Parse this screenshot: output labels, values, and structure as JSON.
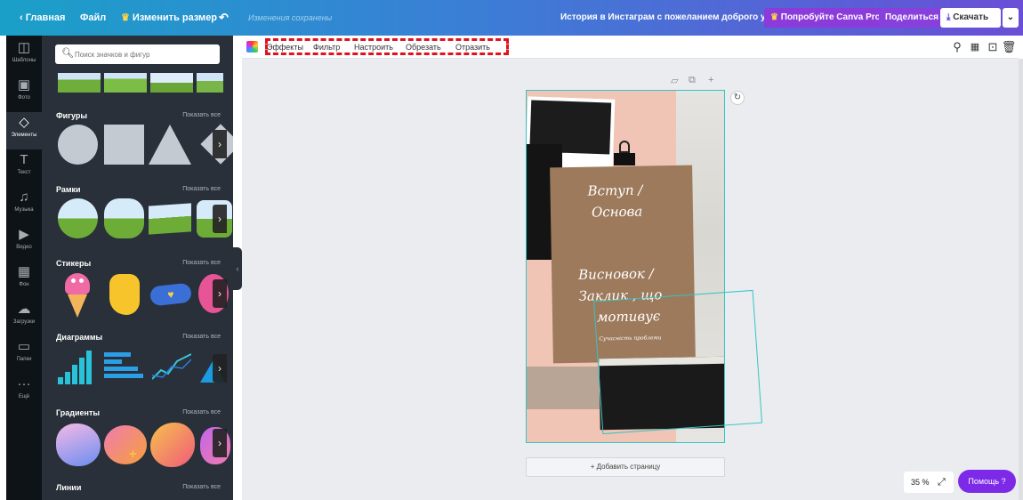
{
  "topbar": {
    "home": "Главная",
    "file": "Файл",
    "resize": "Изменить размер",
    "saved_status": "Изменения сохранены",
    "doc_title": "История в Инстаграм с пожеланием доброго утра",
    "try_pro": "Попробуйте Canva Pro",
    "share": "Поделиться",
    "download": "Скачать"
  },
  "rail": [
    {
      "label": "Шаблоны",
      "icon": "templates-icon",
      "glyph": "◫"
    },
    {
      "label": "Фото",
      "icon": "photo-icon",
      "glyph": "▣"
    },
    {
      "label": "Элементы",
      "icon": "elements-icon",
      "glyph": "◇"
    },
    {
      "label": "Текст",
      "icon": "text-icon",
      "glyph": "T"
    },
    {
      "label": "Музыка",
      "icon": "music-icon",
      "glyph": "♫"
    },
    {
      "label": "Видео",
      "icon": "video-icon",
      "glyph": "▶"
    },
    {
      "label": "Фон",
      "icon": "background-icon",
      "glyph": "▦"
    },
    {
      "label": "Загрузки",
      "icon": "upload-icon",
      "glyph": "☁"
    },
    {
      "label": "Папки",
      "icon": "folder-icon",
      "glyph": "▭"
    },
    {
      "label": "Ещё",
      "icon": "more-icon",
      "glyph": "···"
    }
  ],
  "panel": {
    "search_placeholder": "Поиск значков и фигур",
    "show_all": "Показать все",
    "sections": {
      "shapes": "Фигуры",
      "frames": "Рамки",
      "stickers": "Стикеры",
      "charts": "Диаграммы",
      "gradients": "Градиенты",
      "lines": "Линии"
    }
  },
  "toolbar": {
    "effects": "Эффекты",
    "filter": "Фильтр",
    "adjust": "Настроить",
    "crop": "Обрезать",
    "flip": "Отразить"
  },
  "canvas": {
    "text_intro": "Вступ /",
    "text_base": "Основа",
    "text_conclusion_1": "Висновок /",
    "text_conclusion_2": "Заклик , що",
    "text_conclusion_3": "мотивує",
    "text_small": "Сучасність проблеми",
    "add_page": "+ Добавить страницу"
  },
  "zoom": {
    "value": "35 %"
  },
  "help": {
    "label": "Помощь ?"
  },
  "colors": {
    "accent_purple": "#7d2ae8",
    "selection": "#34c4c4",
    "panel_bg": "#293039",
    "rail_bg": "#0e1318",
    "highlight_red": "#e0121e"
  }
}
